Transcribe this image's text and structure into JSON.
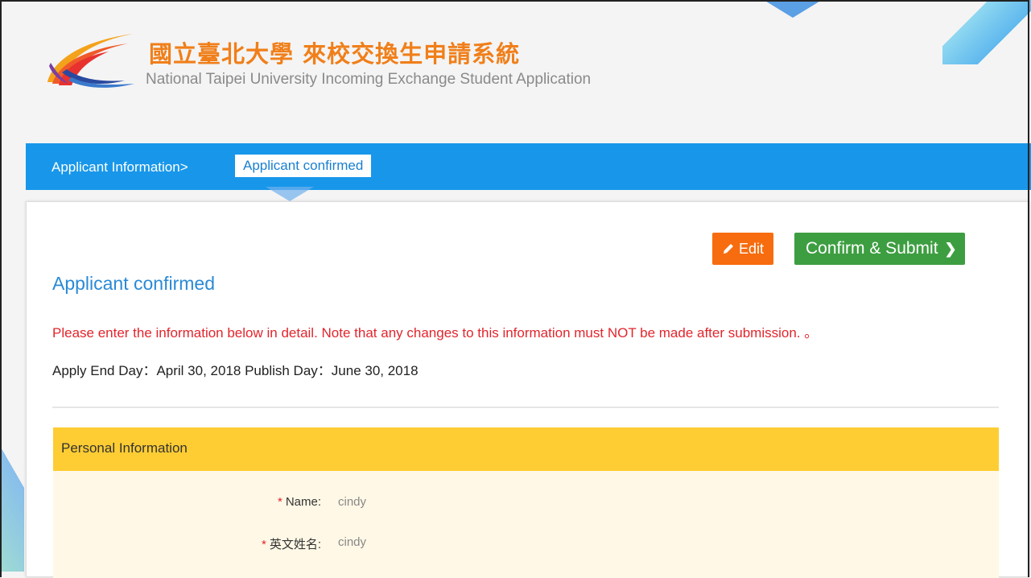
{
  "header": {
    "title_cn": "國立臺北大學 來校交換生申請系統",
    "title_en": "National Taipei University Incoming Exchange Student Application",
    "logo_icon": "ntpu-logo-icon"
  },
  "breadcrumb": {
    "parent": "Applicant Information>",
    "current": "Applicant confirmed"
  },
  "toolbar": {
    "edit_label": "Edit",
    "submit_label": "Confirm & Submit",
    "edit_color": "#f76c0e",
    "submit_color": "#3d9e41"
  },
  "main": {
    "heading": "Applicant confirmed",
    "notice": "Please enter the information below in detail. Note that any changes to this information must NOT be made after submission. 。",
    "dates": "Apply End Day：April 30, 2018 Publish Day：June 30, 2018"
  },
  "personal_info": {
    "title": "Personal Information",
    "fields": [
      {
        "required_mark": "*",
        "label": "Name:",
        "value": "cindy"
      },
      {
        "required_mark": "*",
        "label": "英文姓名:",
        "value": "cindy"
      }
    ]
  },
  "colors": {
    "accent_blue": "#1897ea",
    "panel_yellow": "#fecd33",
    "notice_red": "#e2252c",
    "title_orange": "#f07f1a"
  }
}
